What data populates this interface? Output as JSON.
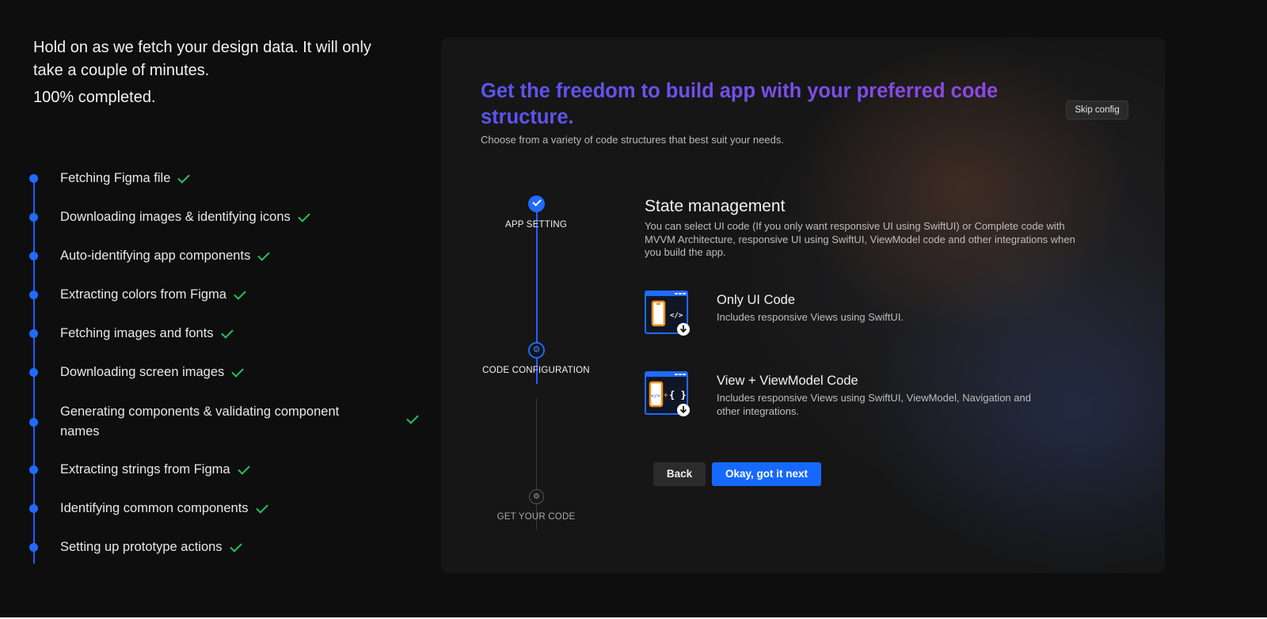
{
  "progress": {
    "headline": "Hold on as we fetch your design data. It will only take a couple of minutes.",
    "percent_text": "100% completed.",
    "percent_value": 100,
    "steps": [
      {
        "label": "Fetching Figma file",
        "done": true
      },
      {
        "label": "Downloading images & identifying icons",
        "done": true
      },
      {
        "label": "Auto-identifying app components",
        "done": true
      },
      {
        "label": "Extracting colors from Figma",
        "done": true
      },
      {
        "label": "Fetching images and fonts",
        "done": true
      },
      {
        "label": "Downloading screen images",
        "done": true
      },
      {
        "label": "Generating components & validating component names",
        "done": true
      },
      {
        "label": "Extracting strings from Figma",
        "done": true
      },
      {
        "label": "Identifying common components",
        "done": true
      },
      {
        "label": "Setting up prototype actions",
        "done": true
      }
    ]
  },
  "panel": {
    "title": "Get the freedom to build app with your preferred code structure.",
    "subtitle": "Choose from a variety of code structures that best suit your needs.",
    "skip_label": "Skip config",
    "stepper": [
      {
        "label": "APP SETTING",
        "state": "done"
      },
      {
        "label": "CODE CONFIGURATION",
        "state": "active"
      },
      {
        "label": "GET YOUR CODE",
        "state": "pending"
      }
    ],
    "section_title": "State management",
    "section_desc": "You can select UI code (If you only want responsive UI using SwiftUI) or Complete code with MVVM Architecture, responsive UI using SwiftUI, ViewModel code and other integrations when you build the app.",
    "options": [
      {
        "title": "Only UI Code",
        "desc": "Includes responsive Views using SwiftUI.",
        "icon": "ui-code-icon"
      },
      {
        "title": "View + ViewModel Code",
        "desc": "Includes responsive Views using SwiftUI, ViewModel, Navigation and other integrations.",
        "icon": "viewmodel-code-icon"
      }
    ],
    "back_label": "Back",
    "next_label": "Okay, got it next"
  },
  "colors": {
    "accent": "#1f6bff",
    "check": "#22c55e",
    "title_gradient_start": "#5a55f0",
    "title_gradient_end": "#9147e6"
  }
}
